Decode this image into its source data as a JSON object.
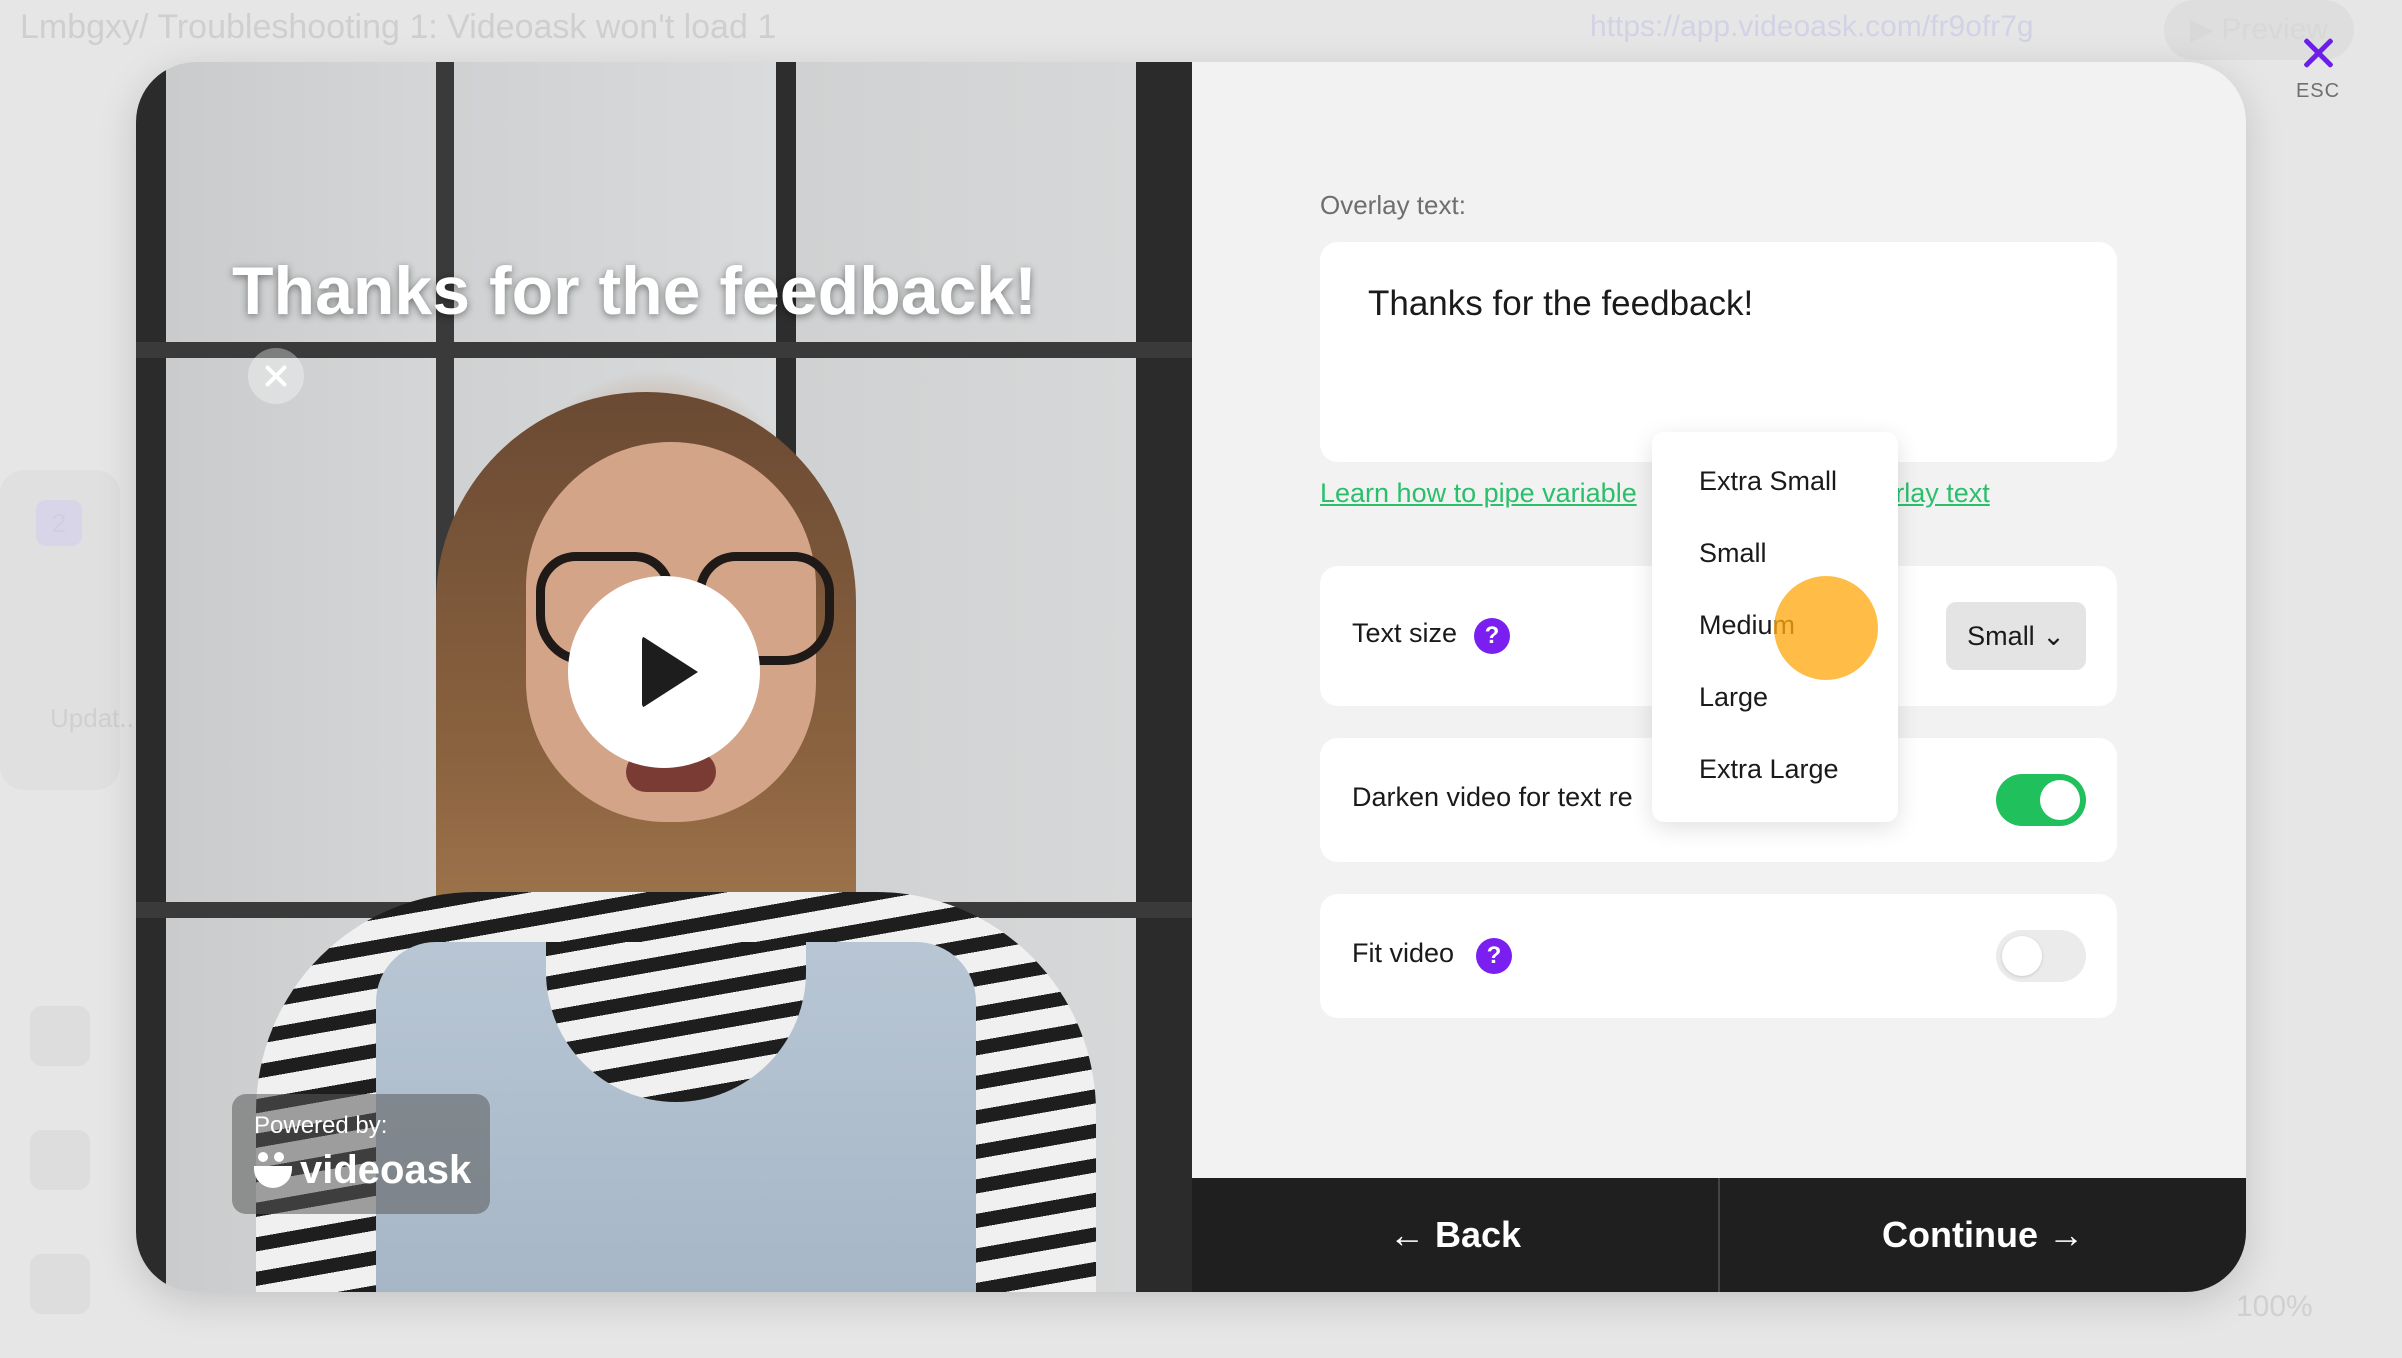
{
  "background": {
    "breadcrumb": "Lmbgxy/ Troubleshooting 1: Videoask won't load 1",
    "url": "https://app.videoask.com/fr9ofr7g",
    "preview_label": "Preview",
    "side_number": "2",
    "side_text": "Updat... Chrom...",
    "zoom": "100%"
  },
  "close": {
    "esc_label": "ESC"
  },
  "video": {
    "overlay_title": "Thanks for the feedback!",
    "powered_label": "Powered by:",
    "logo_text": "videoask"
  },
  "panel": {
    "overlay_label": "Overlay text:",
    "overlay_value": "Thanks for the feedback!",
    "learn_link_left": "Learn how to pipe variable",
    "learn_link_right": "verlay text",
    "text_size_label": "Text size",
    "text_size_value": "Small",
    "darken_label": "Darken video for text re",
    "darken_on": true,
    "fit_label": "Fit video",
    "fit_on": false,
    "help_glyph": "?"
  },
  "dropdown": {
    "options": [
      "Extra Small",
      "Small",
      "Medium",
      "Large",
      "Extra Large"
    ],
    "highlighted": "Medium"
  },
  "footer": {
    "back_label": "Back",
    "continue_label": "Continue"
  },
  "colors": {
    "accent": "#7a1ff0",
    "toggle_on": "#20c05c",
    "link": "#2bbf6c",
    "footer_bg": "#1f1f1f"
  }
}
